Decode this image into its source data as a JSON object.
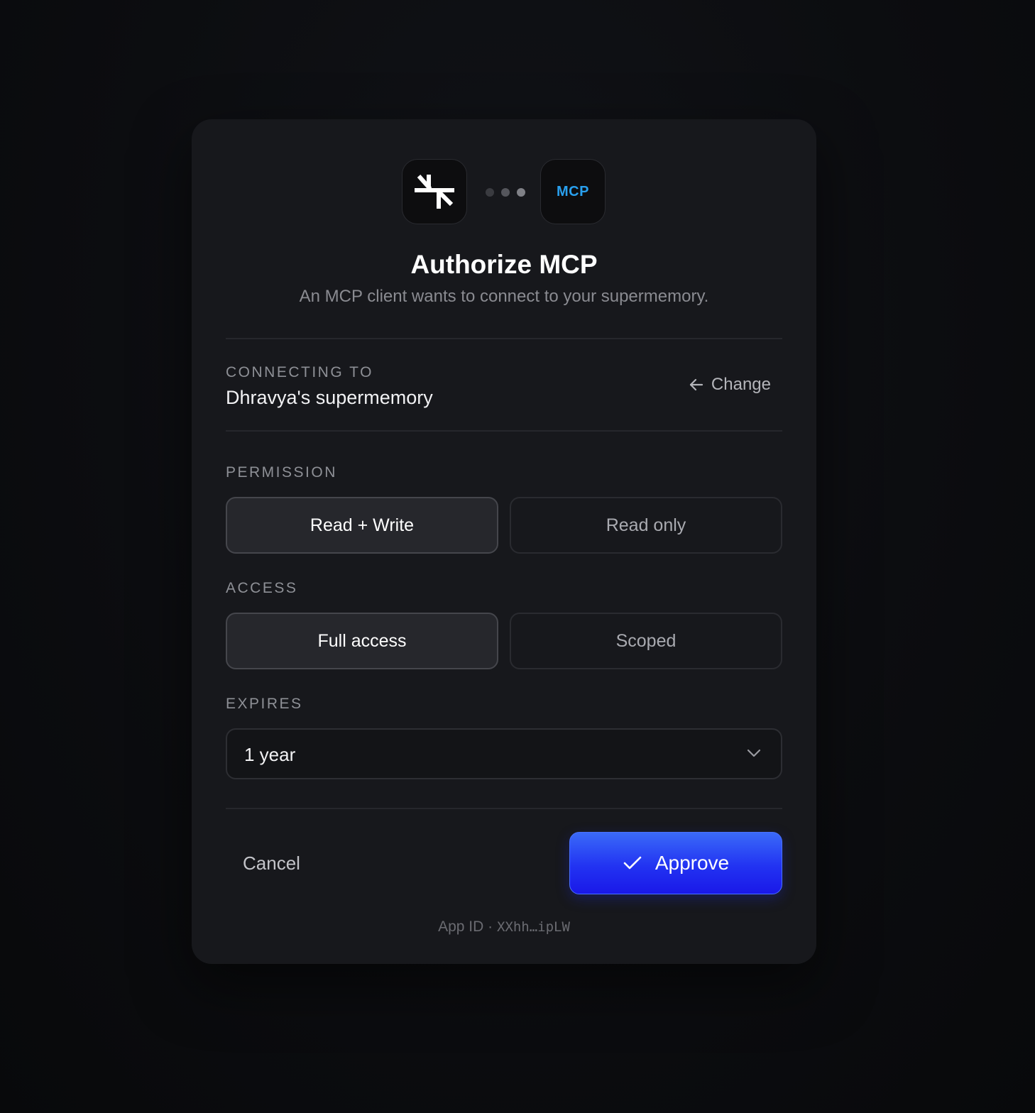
{
  "header": {
    "title": "Authorize MCP",
    "subtitle": "An MCP client wants to connect to your supermemory.",
    "left_logo": "supermemory-logo-icon",
    "right_logo_text": "MCP",
    "connector_dot_colors": [
      "#3a3b40",
      "#55565c",
      "#808187"
    ]
  },
  "connection": {
    "label": "CONNECTING TO",
    "name": "Dhravya's supermemory",
    "change_label": "Change",
    "change_icon": "arrow-left-icon"
  },
  "permission": {
    "label": "PERMISSION",
    "options": [
      "Read + Write",
      "Read only"
    ],
    "selected": "Read + Write"
  },
  "access": {
    "label": "ACCESS",
    "options": [
      "Full access",
      "Scoped"
    ],
    "selected": "Full access"
  },
  "expires": {
    "label": "EXPIRES",
    "value": "1 year",
    "icon": "chevron-down-icon"
  },
  "actions": {
    "cancel_label": "Cancel",
    "approve_label": "Approve",
    "approve_icon": "check-icon"
  },
  "footer": {
    "app_id_prefix": "App ID · ",
    "app_id": "XXhh…ipLW"
  },
  "colors": {
    "accent": "#2233f2",
    "mcp_text": "#29a0ee",
    "card_background": "#17181c"
  }
}
